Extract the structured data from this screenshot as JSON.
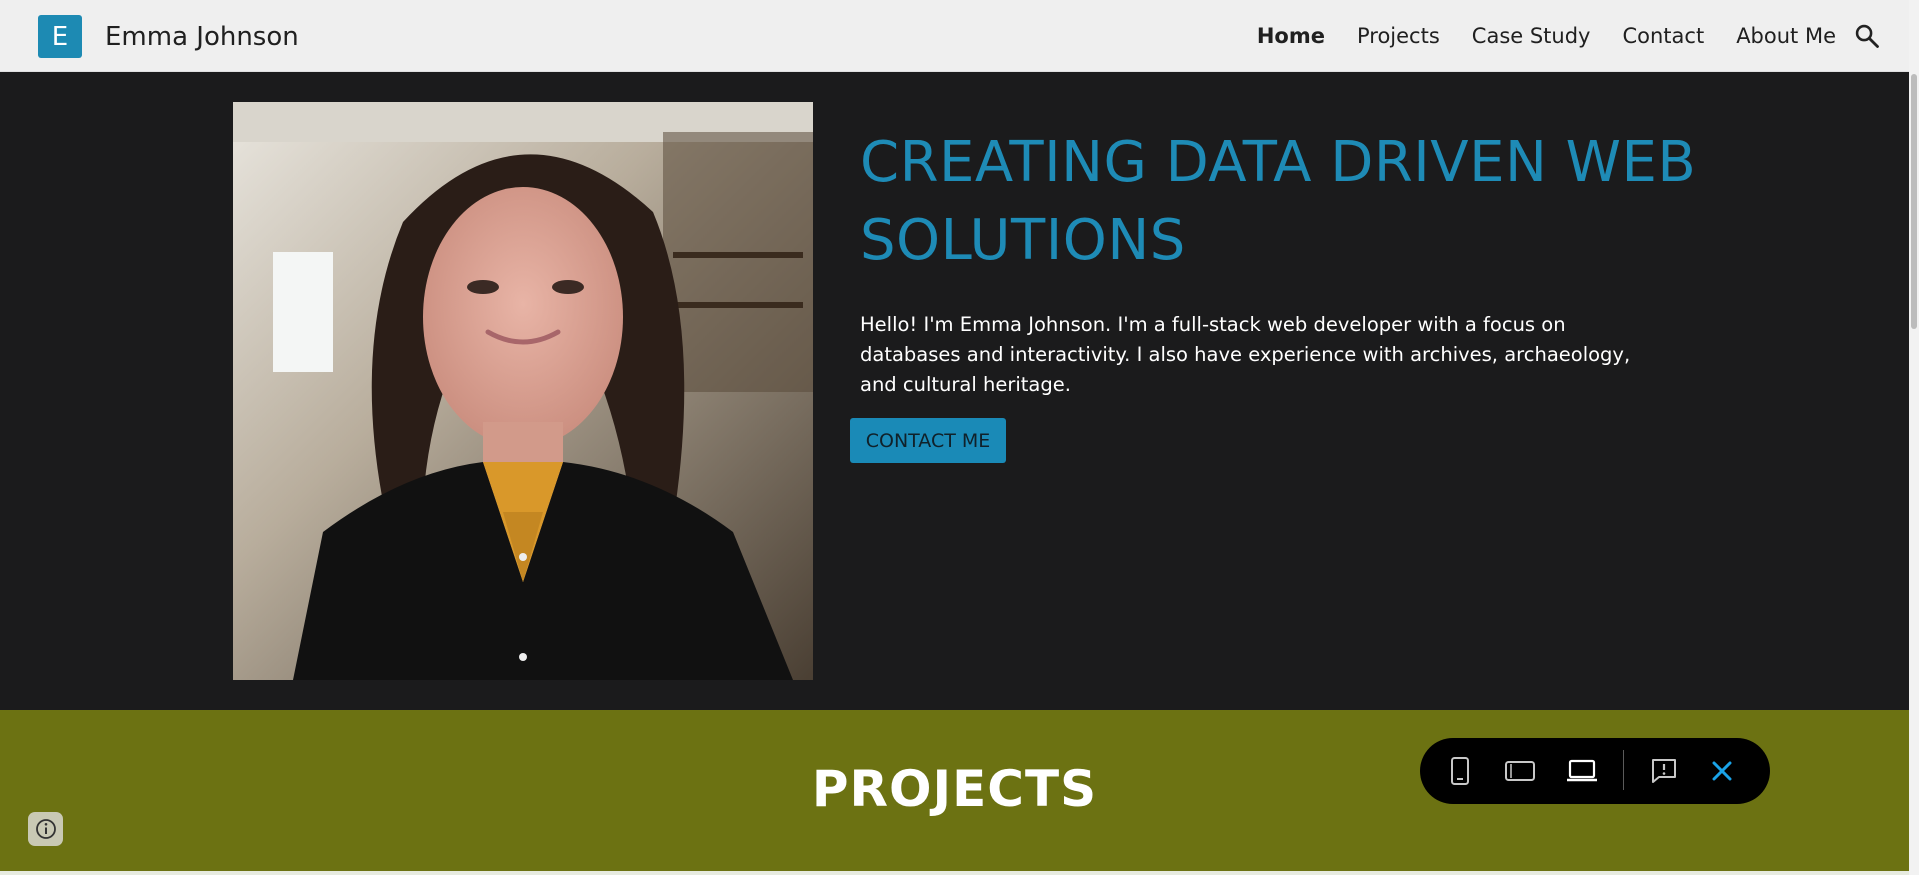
{
  "header": {
    "logo_letter": "E",
    "site_name": "Emma Johnson",
    "nav": [
      "Home",
      "Projects",
      "Case Study",
      "Contact",
      "About Me"
    ],
    "active_nav": "Home"
  },
  "hero": {
    "headline": "CREATING DATA DRIVEN WEB SOLUTIONS",
    "intro": "Hello! I'm Emma Johnson. I'm a full-stack web developer with a focus on databases and interactivity. I also have experience with archives, archaeology, and cultural heritage.",
    "cta_label": "CONTACT ME"
  },
  "projects": {
    "title": "PROJECTS"
  },
  "colors": {
    "accent": "#1e8bb6",
    "hero_bg": "#1b1b1c",
    "projects_bg": "#6c7212",
    "header_bg": "#efefef"
  },
  "icons": {
    "search": "search-icon",
    "phone_preview": "phone-icon",
    "tablet_preview": "tablet-icon",
    "laptop_preview": "laptop-icon",
    "feedback": "report-issue-icon",
    "close": "close-icon",
    "info": "info-icon"
  }
}
